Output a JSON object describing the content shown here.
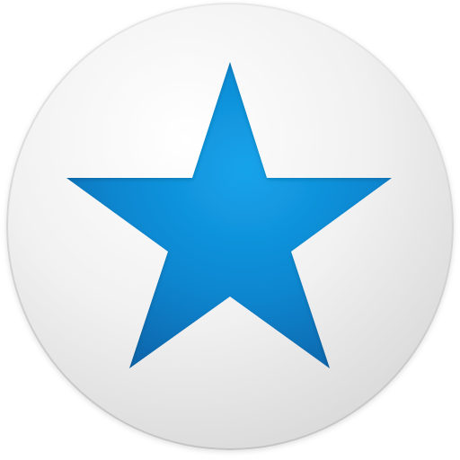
{
  "icon": {
    "name": "star-icon",
    "shape": "five-point-star",
    "background": "circular-badge"
  },
  "colors": {
    "star_light": "#1aa6ec",
    "star_dark": "#0a6bb0",
    "badge_top": "#fdfdfd",
    "badge_bottom": "#dcdcdc",
    "badge_rim": "#d0d0d0"
  }
}
